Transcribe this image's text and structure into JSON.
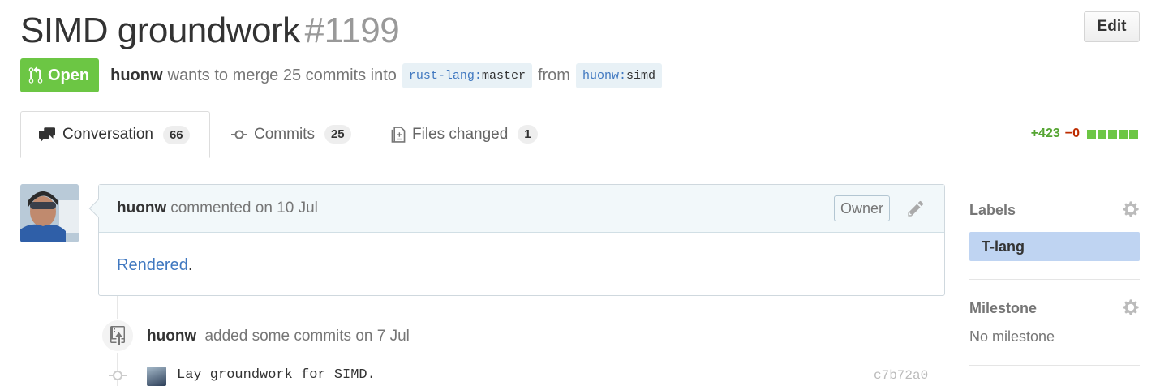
{
  "header": {
    "title": "SIMD groundwork",
    "number": "#1199",
    "edit_label": "Edit"
  },
  "state": {
    "label": "Open",
    "color": "#6cc644"
  },
  "merge_info": {
    "author": "huonw",
    "text": "wants to merge 25 commits into",
    "base_owner": "rust-lang",
    "base_branch": "master",
    "from_text": "from",
    "head_owner": "huonw",
    "head_branch": "simd"
  },
  "tabs": [
    {
      "label": "Conversation",
      "count": "66",
      "icon": "comment-discussion-icon"
    },
    {
      "label": "Commits",
      "count": "25",
      "icon": "git-commit-icon"
    },
    {
      "label": "Files changed",
      "count": "1",
      "icon": "diff-icon"
    }
  ],
  "diffstat": {
    "additions": "+423",
    "deletions": "−0",
    "blocks": 5
  },
  "comment": {
    "author": "huonw",
    "action": "commented on 10 Jul",
    "badge": "Owner",
    "body_link": "Rendered",
    "body_suffix": "."
  },
  "event": {
    "author": "huonw",
    "text": "added some commits on 7 Jul"
  },
  "commits": [
    {
      "message": "Lay groundwork for SIMD.",
      "sha": "c7b72a0"
    }
  ],
  "sidebar": {
    "labels_heading": "Labels",
    "labels": [
      "T-lang"
    ],
    "milestone_heading": "Milestone",
    "milestone_value": "No milestone"
  },
  "colors": {
    "addition": "#55a532",
    "deletion": "#bd2c00",
    "link": "#4078c0",
    "label_bg": "#bfd4f2"
  }
}
